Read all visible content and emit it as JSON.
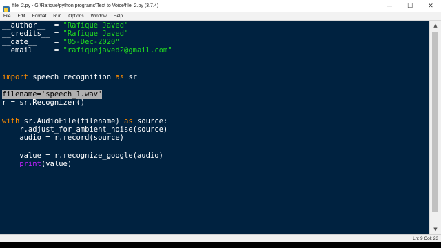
{
  "window": {
    "title": "file_2.py - G:\\Rafique\\python programs\\Text to Voice\\file_2.py (3.7.4)",
    "minimize_symbol": "—",
    "maximize_symbol": "☐",
    "close_symbol": "✕"
  },
  "menu": {
    "items": [
      "File",
      "Edit",
      "Format",
      "Run",
      "Options",
      "Window",
      "Help"
    ]
  },
  "code": {
    "author_lhs": "__author__  = ",
    "author_val": "\"Rafique Javed\"",
    "credits_lhs": "__credits__ = ",
    "credits_val": "\"Rafique Javed\"",
    "date_lhs": "__date__    = ",
    "date_val": "\"05-Dec-2020\"",
    "email_lhs": "__email__   = ",
    "email_val": "\"rafiquejaved2@gmail.com\"",
    "import_kw": "import",
    "import_mod": " speech_recognition ",
    "as_kw": "as",
    "import_alias": " sr",
    "filename_line": "filename='speech_1.wav'",
    "recognizer_line": "r = sr.Recognizer()",
    "with_kw": "with",
    "with_mid": " sr.AudioFile(filename) ",
    "as_kw2": "as",
    "with_end": " source:",
    "adjust_line": "    r.adjust_for_ambient_noise(source)",
    "audio_line": "    audio = r.record(source)",
    "value_line": "    value = r.recognize_google(audio)",
    "print_indent": "    ",
    "print_kw": "print",
    "print_args": "(value)"
  },
  "status": {
    "position": "Ln: 9   Col: 23"
  },
  "colors": {
    "background": "#002240",
    "string": "#21d821",
    "keyword": "#ff8c00",
    "builtin": "#c020ff",
    "selection": "#b0b0b0"
  },
  "icons": {
    "app": "idle-feather-icon",
    "scroll_up": "scroll-up-arrow-icon",
    "scroll_down": "scroll-down-arrow-icon"
  }
}
